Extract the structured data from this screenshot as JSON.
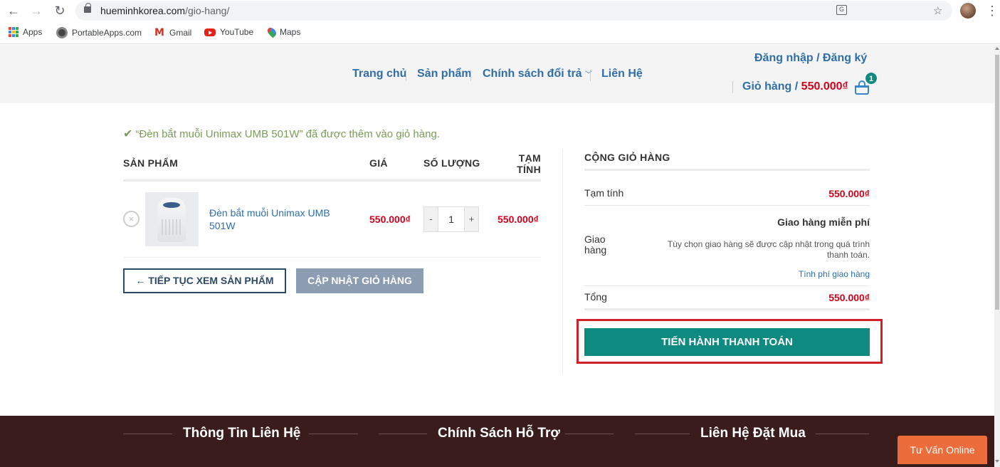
{
  "browser": {
    "url_host": "hueminhkorea.com",
    "url_path": "/gio-hang/",
    "bookmarks": [
      {
        "label": "Apps",
        "icon": "apps-grid-icon"
      },
      {
        "label": "PortableApps.com",
        "icon": "portableapps-icon"
      },
      {
        "label": "Gmail",
        "icon": "gmail-icon"
      },
      {
        "label": "YouTube",
        "icon": "youtube-icon"
      },
      {
        "label": "Maps",
        "icon": "maps-icon"
      }
    ]
  },
  "header": {
    "nav": [
      "Trang chủ",
      "Sản phẩm",
      "Chính sách đổi trả",
      "Liên Hệ"
    ],
    "login": "Đăng nhập / Đăng ký",
    "cart_label": "Giỏ hàng /",
    "cart_amount": "550.000₫",
    "cart_count": "1"
  },
  "notice": "“Đèn bắt muỗi Unimax UMB 501W” đã được thêm vào giỏ hàng.",
  "cart": {
    "headers": {
      "product": "SẢN PHẨM",
      "price": "GIÁ",
      "quantity": "SỐ LƯỢNG",
      "subtotal_line1": "TẠM",
      "subtotal_line2": "TÍNH"
    },
    "items": [
      {
        "name": "Đèn bắt muỗi Unimax UMB 501W",
        "price": "550.000₫",
        "quantity": "1",
        "subtotal": "550.000₫",
        "remove": "×",
        "minus": "-",
        "plus": "+"
      }
    ],
    "continue_button": "← TIẾP TỤC XEM SẢN PHẨM",
    "update_button": "CẬP NHẬT GIỎ HÀNG"
  },
  "totals": {
    "title": "CỘNG GIỎ HÀNG",
    "subtotal_label": "Tạm tính",
    "subtotal_value": "550.000₫",
    "shipping_label": "Giao hàng",
    "shipping_method": "Giao hàng miễn phí",
    "shipping_note": "Tùy chọn giao hàng sẽ được cập nhật trong quá trình thanh toán.",
    "shipping_calc": "Tính phí giao hàng",
    "total_label": "Tổng",
    "total_value": "550.000₫",
    "checkout_button": "TIẾN HÀNH THANH TOÁN"
  },
  "footer": {
    "columns": [
      "Thông Tin Liên Hệ",
      "Chính Sách Hỗ Trợ",
      "Liên Hệ Đặt Mua"
    ]
  },
  "chat_button": "Tư Vấn Online",
  "colors": {
    "link_blue": "#2f6ea7",
    "price_red": "#d0021b",
    "teal": "#0e8a80",
    "footer_bg": "#3a1c1c",
    "chat_orange": "#ec6d3c",
    "highlight_red": "#d0212b"
  }
}
